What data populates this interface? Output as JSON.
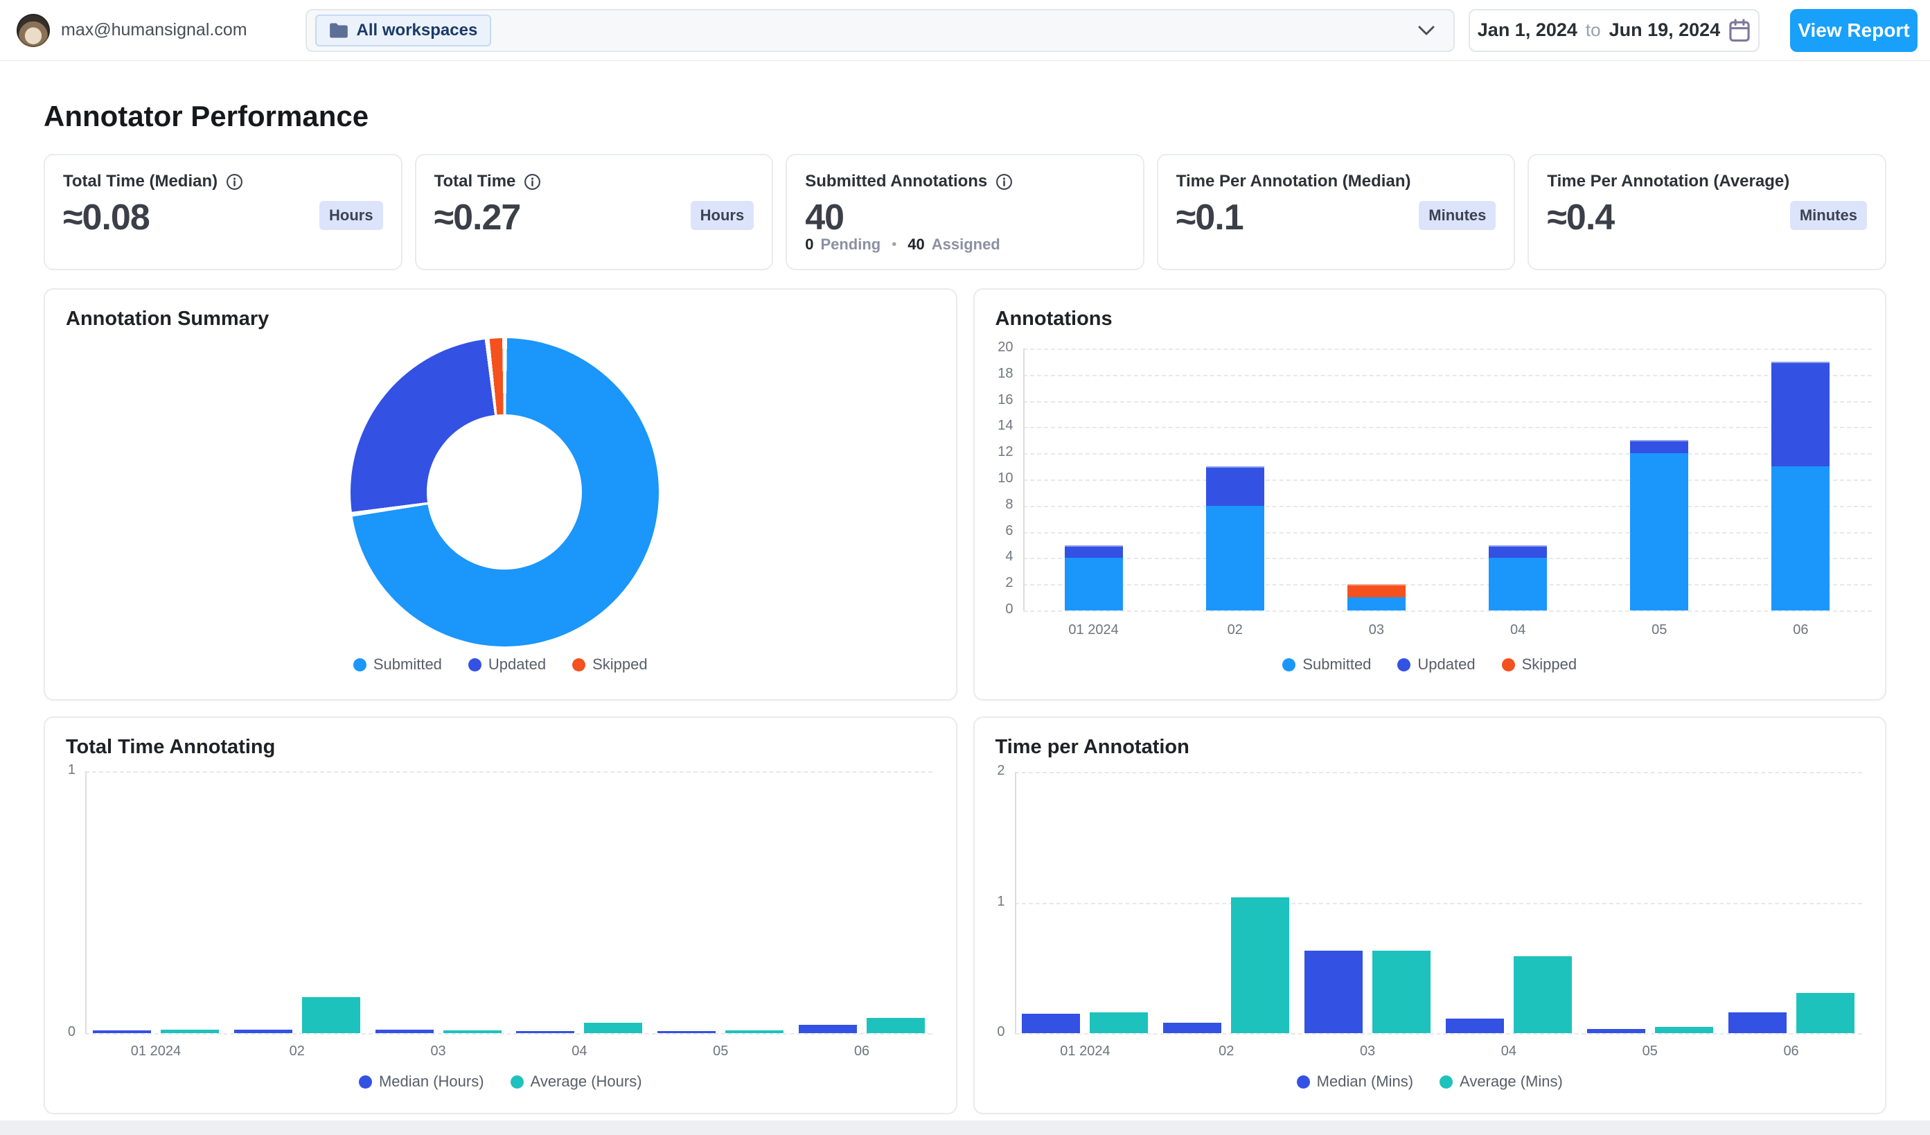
{
  "topbar": {
    "email": "max@humansignal.com",
    "workspace_filter": "All workspaces",
    "date_from": "Jan 1, 2024",
    "date_to_word": "to",
    "date_to": "Jun 19, 2024",
    "view_report": "View Report"
  },
  "page": {
    "title": "Annotator Performance"
  },
  "cards": [
    {
      "label": "Total Time (Median)",
      "value": "≈0.08",
      "unit": "Hours"
    },
    {
      "label": "Total Time",
      "value": "≈0.27",
      "unit": "Hours"
    },
    {
      "label": "Submitted Annotations",
      "value": "40",
      "unit": "",
      "footer": {
        "pending_value": "0",
        "pending_label": "Pending",
        "separator": "•",
        "assigned_value": "40",
        "assigned_label": "Assigned"
      }
    },
    {
      "label": "Time Per Annotation (Median)",
      "value": "≈0.1",
      "unit": "Minutes"
    },
    {
      "label": "Time Per Annotation (Average)",
      "value": "≈0.4",
      "unit": "Minutes"
    }
  ],
  "colors": {
    "submitted": "#1B96FB",
    "updated": "#3351E3",
    "skipped": "#F4511E",
    "median": "#3351E3",
    "average": "#1EC2BC",
    "accent_button": "#18A0FB",
    "badge_bg": "#DCE4FB"
  },
  "chart_data": [
    {
      "id": "annotation_summary",
      "type": "pie",
      "title": "Annotation Summary",
      "labels": [
        "Submitted",
        "Updated",
        "Skipped"
      ],
      "values": [
        40,
        14,
        1
      ],
      "colors": [
        "#1B96FB",
        "#3351E3",
        "#F4511E"
      ],
      "donut": true,
      "legend_position": "bottom"
    },
    {
      "id": "annotations",
      "type": "bar",
      "stacked": true,
      "title": "Annotations",
      "categories": [
        "01 2024",
        "02",
        "03",
        "04",
        "05",
        "06"
      ],
      "series": [
        {
          "name": "Submitted",
          "color": "#1B96FB",
          "values": [
            4,
            8,
            1,
            4,
            12,
            11
          ]
        },
        {
          "name": "Updated",
          "color": "#3351E3",
          "values": [
            1,
            3,
            0,
            1,
            1,
            8
          ]
        },
        {
          "name": "Skipped",
          "color": "#F4511E",
          "values": [
            0,
            0,
            1,
            0,
            0,
            0
          ]
        }
      ],
      "ylim": [
        0,
        20
      ],
      "yticks": [
        0,
        2,
        4,
        6,
        8,
        10,
        12,
        14,
        16,
        18,
        20
      ],
      "grid": "dashed",
      "legend_position": "bottom"
    },
    {
      "id": "total_time_annotating",
      "type": "bar",
      "grouped": true,
      "title": "Total Time Annotating",
      "categories": [
        "01 2024",
        "02",
        "03",
        "04",
        "05",
        "06"
      ],
      "series": [
        {
          "name": "Median (Hours)",
          "color": "#3351E3",
          "values": [
            0.011,
            0.014,
            0.013,
            0.008,
            0.007,
            0.033
          ]
        },
        {
          "name": "Average (Hours)",
          "color": "#1EC2BC",
          "values": [
            0.013,
            0.137,
            0.011,
            0.04,
            0.01,
            0.058
          ]
        }
      ],
      "ylim": [
        0,
        1
      ],
      "yticks": [
        0,
        1
      ],
      "grid": "dashed",
      "legend_position": "bottom"
    },
    {
      "id": "time_per_annotation",
      "type": "bar",
      "grouped": true,
      "title": "Time per Annotation",
      "categories": [
        "01 2024",
        "02",
        "03",
        "04",
        "05",
        "06"
      ],
      "series": [
        {
          "name": "Median (Mins)",
          "color": "#3351E3",
          "values": [
            0.15,
            0.08,
            0.63,
            0.11,
            0.03,
            0.16
          ]
        },
        {
          "name": "Average (Mins)",
          "color": "#1EC2BC",
          "values": [
            0.16,
            1.04,
            0.63,
            0.59,
            0.05,
            0.31
          ]
        }
      ],
      "ylim": [
        0,
        2
      ],
      "yticks": [
        0,
        1,
        2
      ],
      "grid": "dashed",
      "legend_position": "bottom"
    }
  ]
}
